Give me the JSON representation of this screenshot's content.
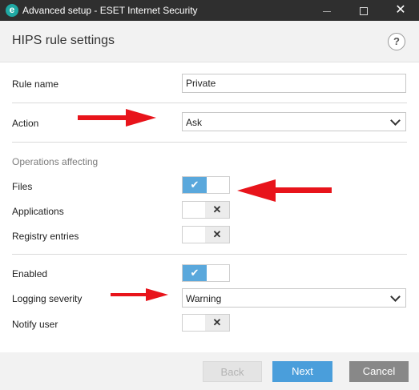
{
  "window": {
    "title": "Advanced setup - ESET Internet Security",
    "app_icon_letter": "e",
    "minimize_icon": "minimize-icon",
    "maximize_icon": "maximize-icon",
    "close_glyph": "✕"
  },
  "header": {
    "title": "HIPS rule settings",
    "help_glyph": "?"
  },
  "form": {
    "rule_name_label": "Rule name",
    "rule_name_value": "Private",
    "action_label": "Action",
    "action_value": "Ask",
    "operations_affecting_label": "Operations affecting",
    "files_label": "Files",
    "files_enabled": true,
    "applications_label": "Applications",
    "applications_enabled": false,
    "registry_label": "Registry entries",
    "registry_enabled": false,
    "enabled_label": "Enabled",
    "enabled_enabled": true,
    "logging_label": "Logging severity",
    "logging_value": "Warning",
    "notify_label": "Notify user",
    "notify_enabled": false
  },
  "toggle_glyphs": {
    "on": "✔",
    "off": "✕"
  },
  "annotation_color": "#e8141b",
  "buttons": {
    "back": "Back",
    "next": "Next",
    "cancel": "Cancel"
  }
}
